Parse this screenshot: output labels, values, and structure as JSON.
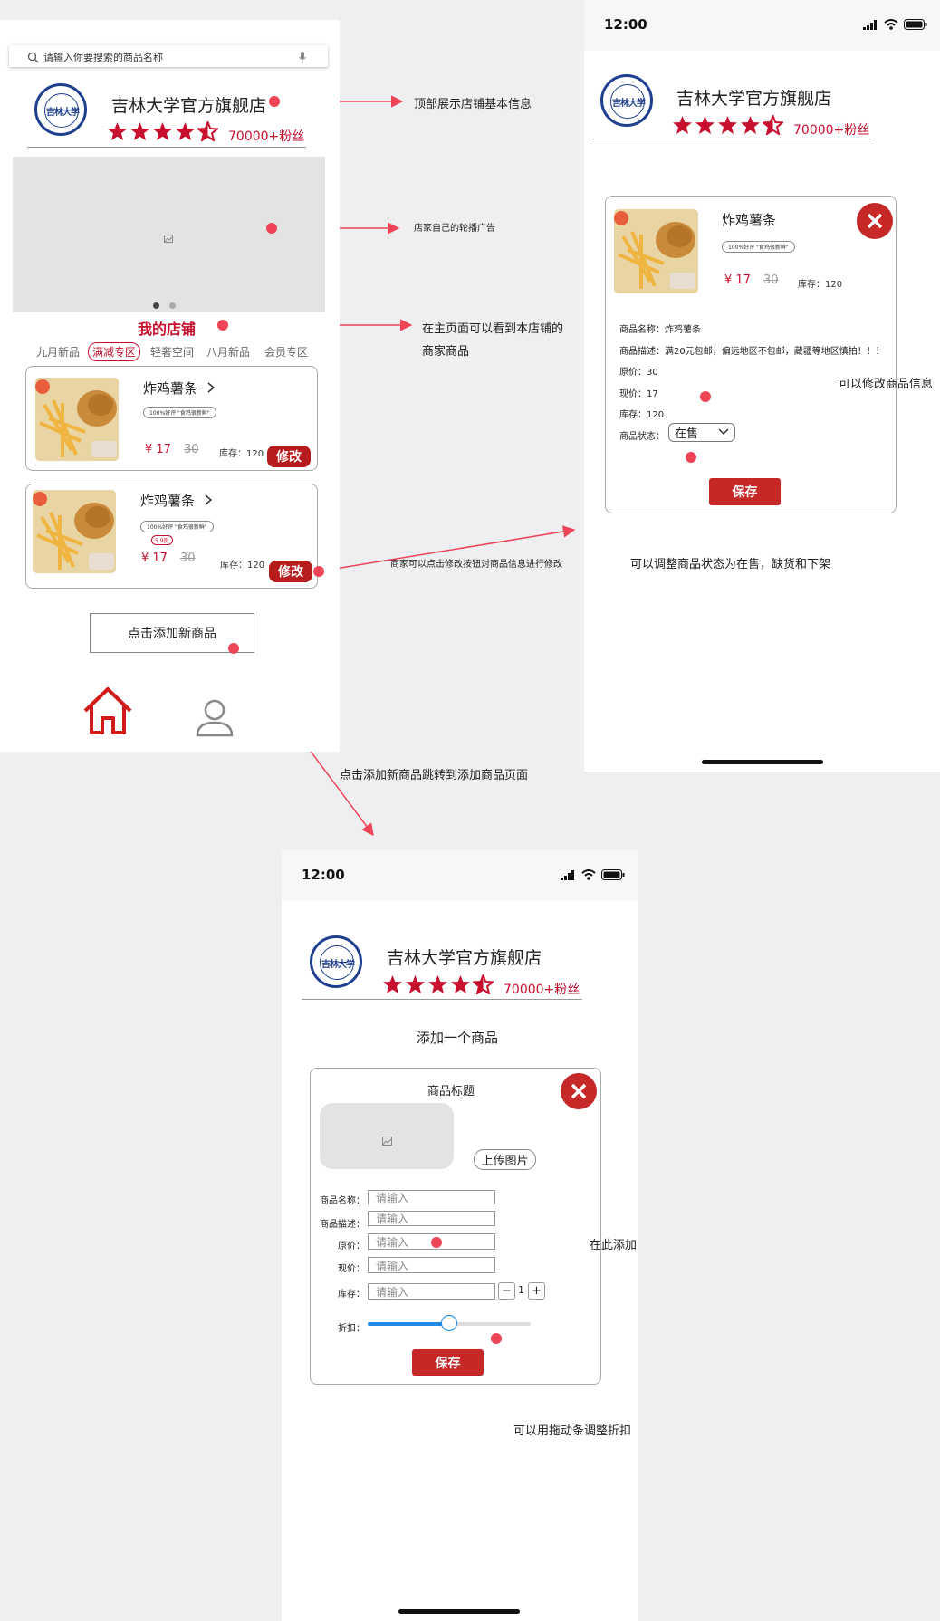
{
  "screen1": {
    "search_placeholder": "请输入你要搜索的商品名称",
    "shop_name": "吉林大学官方旗舰店",
    "fans": "70000+粉丝",
    "my_shop": "我的店铺",
    "tabs": [
      "九月新品",
      "满减专区",
      "轻奢空间",
      "八月新品",
      "会员专区"
    ],
    "products": [
      {
        "title": "炸鸡薯条",
        "badge": "100%好评 \"食鸡很新鲜\"",
        "price": "¥ 17",
        "old_price": "30",
        "stock": "库存：120",
        "edit": "修改"
      },
      {
        "title": "炸鸡薯条",
        "badge": "100%好评 \"食鸡很新鲜\"",
        "discount": "5.9折",
        "price": "¥ 17",
        "old_price": "30",
        "stock": "库存：120",
        "edit": "修改"
      }
    ],
    "add_button": "点击添加新商品"
  },
  "screen2": {
    "time": "12:00",
    "shop_name": "吉林大学官方旗舰店",
    "fans": "70000+粉丝",
    "product_title": "炸鸡薯条",
    "badge": "100%好评 \"食鸡很新鲜\"",
    "price": "¥ 17",
    "old_price": "30",
    "stock": "库存：120",
    "details": [
      "商品名称：炸鸡薯条",
      "商品描述：满20元包邮，偏远地区不包邮，藏疆等地区慎拍！！！",
      "原价：30",
      "现价：17",
      "库存：120"
    ],
    "status_label": "商品状态：",
    "status_value": "在售",
    "save": "保存"
  },
  "screen3": {
    "time": "12:00",
    "shop_name": "吉林大学官方旗舰店",
    "fans": "70000+粉丝",
    "heading": "添加一个商品",
    "form_title": "商品标题",
    "upload": "上传图片",
    "fields": [
      {
        "label": "商品名称：",
        "placeholder": "请输入"
      },
      {
        "label": "商品描述：",
        "placeholder": "请输入"
      },
      {
        "label": "原价：",
        "placeholder": "请输入"
      },
      {
        "label": "现价：",
        "placeholder": "请输入"
      },
      {
        "label": "库存：",
        "placeholder": "请输入"
      }
    ],
    "stepper_value": "1",
    "discount_label": "折扣：",
    "slider_level": 0.5,
    "save": "保存"
  },
  "annotations": {
    "a1": "顶部展示店铺基本信息",
    "a2": "店家自己的轮播广告",
    "a3_line1": "在主页面可以看到本店铺的",
    "a3_line2": "商家商品",
    "a4": "商家可以点击修改按钮对商品信息进行修改",
    "a5": "点击添加新商品跳转到添加商品页面",
    "a6": "可以修改商品信息",
    "a7": "可以调整商品状态为在售，缺货和下架",
    "a8": "在此添加",
    "a9": "可以用拖动条调整折扣"
  },
  "icons": {
    "search": "search-icon",
    "mic": "mic-icon",
    "home": "home-icon",
    "user": "user-icon",
    "close": "close-icon",
    "image_placeholder": "image-icon",
    "chevron": "chevron-right-icon",
    "signal": "signal-icon",
    "wifi": "wifi-icon",
    "battery": "battery-icon"
  },
  "colors": {
    "accent": "#c8102e",
    "annotation": "#ee4455",
    "logo_blue": "#1e3f8f"
  }
}
